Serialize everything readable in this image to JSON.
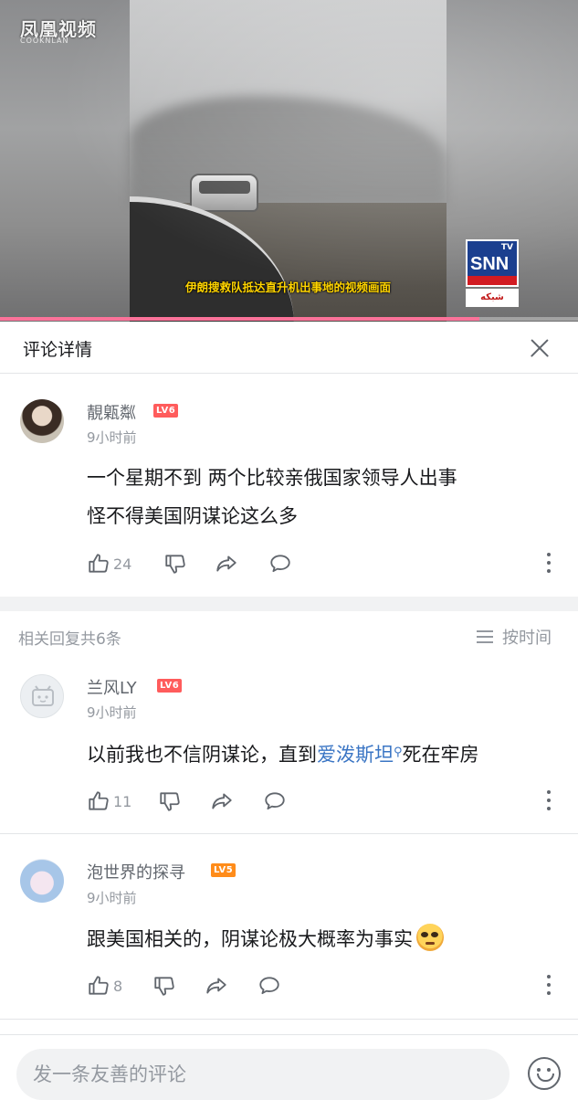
{
  "video": {
    "watermark": "凤凰视频",
    "watermark_sub": "COOKNLAN",
    "caption": "伊朗搜救队抵达直升机出事地的视频画面",
    "channel_logo": "SNN",
    "channel_logo_tv": "TV",
    "channel_logo_sub": "شبکه",
    "progress": 0.83
  },
  "header": {
    "title": "评论详情"
  },
  "main_comment": {
    "username": "靚甈粼",
    "level": "LV6",
    "time": "9小时前",
    "text_line1": "一个星期不到  两个比较亲俄国家领导人出事",
    "text_line2": "怪不得美国阴谋论这么多",
    "likes": "24"
  },
  "replies_header": {
    "count_label": "相关回复共6条",
    "sort_label": "按时间"
  },
  "replies": [
    {
      "username": "兰风LY",
      "level": "LV6",
      "time": "9小时前",
      "text_before": "以前我也不信阴谋论，直到",
      "text_link": "爱泼斯坦",
      "text_after": "死在牢房",
      "likes": "11"
    },
    {
      "username": "泡世界的探寻",
      "level": "LV5",
      "time": "9小时前",
      "text": "跟美国相关的，阴谋论极大概率为事实",
      "likes": "8"
    }
  ],
  "input": {
    "placeholder": "发一条友善的评论"
  },
  "icons": {
    "like": "thumbs-up-icon",
    "dislike": "thumbs-down-icon",
    "share": "share-icon",
    "reply": "comment-icon",
    "more": "more-vertical-icon",
    "close": "close-icon",
    "sort": "sort-icon",
    "emoji": "emoji-icon"
  },
  "colors": {
    "accent_pink": "#fb7299",
    "link_blue": "#3a75c4",
    "lv6": "#ff5c5c",
    "lv5": "#ff8c1a",
    "caption_yellow": "#ffd400"
  }
}
